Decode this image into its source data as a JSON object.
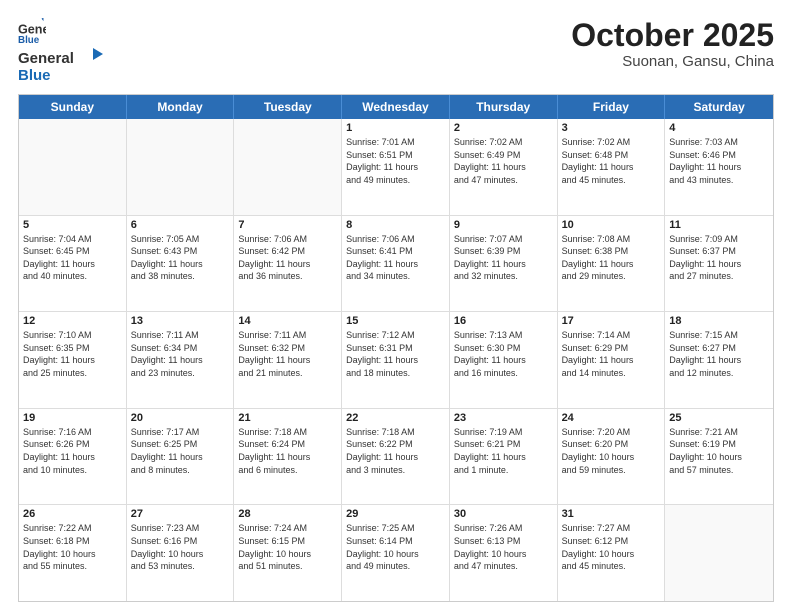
{
  "logo": {
    "general": "General",
    "blue": "Blue"
  },
  "title": "October 2025",
  "subtitle": "Suonan, Gansu, China",
  "weekdays": [
    "Sunday",
    "Monday",
    "Tuesday",
    "Wednesday",
    "Thursday",
    "Friday",
    "Saturday"
  ],
  "rows": [
    [
      {
        "day": "",
        "info": ""
      },
      {
        "day": "",
        "info": ""
      },
      {
        "day": "",
        "info": ""
      },
      {
        "day": "1",
        "info": "Sunrise: 7:01 AM\nSunset: 6:51 PM\nDaylight: 11 hours\nand 49 minutes."
      },
      {
        "day": "2",
        "info": "Sunrise: 7:02 AM\nSunset: 6:49 PM\nDaylight: 11 hours\nand 47 minutes."
      },
      {
        "day": "3",
        "info": "Sunrise: 7:02 AM\nSunset: 6:48 PM\nDaylight: 11 hours\nand 45 minutes."
      },
      {
        "day": "4",
        "info": "Sunrise: 7:03 AM\nSunset: 6:46 PM\nDaylight: 11 hours\nand 43 minutes."
      }
    ],
    [
      {
        "day": "5",
        "info": "Sunrise: 7:04 AM\nSunset: 6:45 PM\nDaylight: 11 hours\nand 40 minutes."
      },
      {
        "day": "6",
        "info": "Sunrise: 7:05 AM\nSunset: 6:43 PM\nDaylight: 11 hours\nand 38 minutes."
      },
      {
        "day": "7",
        "info": "Sunrise: 7:06 AM\nSunset: 6:42 PM\nDaylight: 11 hours\nand 36 minutes."
      },
      {
        "day": "8",
        "info": "Sunrise: 7:06 AM\nSunset: 6:41 PM\nDaylight: 11 hours\nand 34 minutes."
      },
      {
        "day": "9",
        "info": "Sunrise: 7:07 AM\nSunset: 6:39 PM\nDaylight: 11 hours\nand 32 minutes."
      },
      {
        "day": "10",
        "info": "Sunrise: 7:08 AM\nSunset: 6:38 PM\nDaylight: 11 hours\nand 29 minutes."
      },
      {
        "day": "11",
        "info": "Sunrise: 7:09 AM\nSunset: 6:37 PM\nDaylight: 11 hours\nand 27 minutes."
      }
    ],
    [
      {
        "day": "12",
        "info": "Sunrise: 7:10 AM\nSunset: 6:35 PM\nDaylight: 11 hours\nand 25 minutes."
      },
      {
        "day": "13",
        "info": "Sunrise: 7:11 AM\nSunset: 6:34 PM\nDaylight: 11 hours\nand 23 minutes."
      },
      {
        "day": "14",
        "info": "Sunrise: 7:11 AM\nSunset: 6:32 PM\nDaylight: 11 hours\nand 21 minutes."
      },
      {
        "day": "15",
        "info": "Sunrise: 7:12 AM\nSunset: 6:31 PM\nDaylight: 11 hours\nand 18 minutes."
      },
      {
        "day": "16",
        "info": "Sunrise: 7:13 AM\nSunset: 6:30 PM\nDaylight: 11 hours\nand 16 minutes."
      },
      {
        "day": "17",
        "info": "Sunrise: 7:14 AM\nSunset: 6:29 PM\nDaylight: 11 hours\nand 14 minutes."
      },
      {
        "day": "18",
        "info": "Sunrise: 7:15 AM\nSunset: 6:27 PM\nDaylight: 11 hours\nand 12 minutes."
      }
    ],
    [
      {
        "day": "19",
        "info": "Sunrise: 7:16 AM\nSunset: 6:26 PM\nDaylight: 11 hours\nand 10 minutes."
      },
      {
        "day": "20",
        "info": "Sunrise: 7:17 AM\nSunset: 6:25 PM\nDaylight: 11 hours\nand 8 minutes."
      },
      {
        "day": "21",
        "info": "Sunrise: 7:18 AM\nSunset: 6:24 PM\nDaylight: 11 hours\nand 6 minutes."
      },
      {
        "day": "22",
        "info": "Sunrise: 7:18 AM\nSunset: 6:22 PM\nDaylight: 11 hours\nand 3 minutes."
      },
      {
        "day": "23",
        "info": "Sunrise: 7:19 AM\nSunset: 6:21 PM\nDaylight: 11 hours\nand 1 minute."
      },
      {
        "day": "24",
        "info": "Sunrise: 7:20 AM\nSunset: 6:20 PM\nDaylight: 10 hours\nand 59 minutes."
      },
      {
        "day": "25",
        "info": "Sunrise: 7:21 AM\nSunset: 6:19 PM\nDaylight: 10 hours\nand 57 minutes."
      }
    ],
    [
      {
        "day": "26",
        "info": "Sunrise: 7:22 AM\nSunset: 6:18 PM\nDaylight: 10 hours\nand 55 minutes."
      },
      {
        "day": "27",
        "info": "Sunrise: 7:23 AM\nSunset: 6:16 PM\nDaylight: 10 hours\nand 53 minutes."
      },
      {
        "day": "28",
        "info": "Sunrise: 7:24 AM\nSunset: 6:15 PM\nDaylight: 10 hours\nand 51 minutes."
      },
      {
        "day": "29",
        "info": "Sunrise: 7:25 AM\nSunset: 6:14 PM\nDaylight: 10 hours\nand 49 minutes."
      },
      {
        "day": "30",
        "info": "Sunrise: 7:26 AM\nSunset: 6:13 PM\nDaylight: 10 hours\nand 47 minutes."
      },
      {
        "day": "31",
        "info": "Sunrise: 7:27 AM\nSunset: 6:12 PM\nDaylight: 10 hours\nand 45 minutes."
      },
      {
        "day": "",
        "info": ""
      }
    ]
  ]
}
